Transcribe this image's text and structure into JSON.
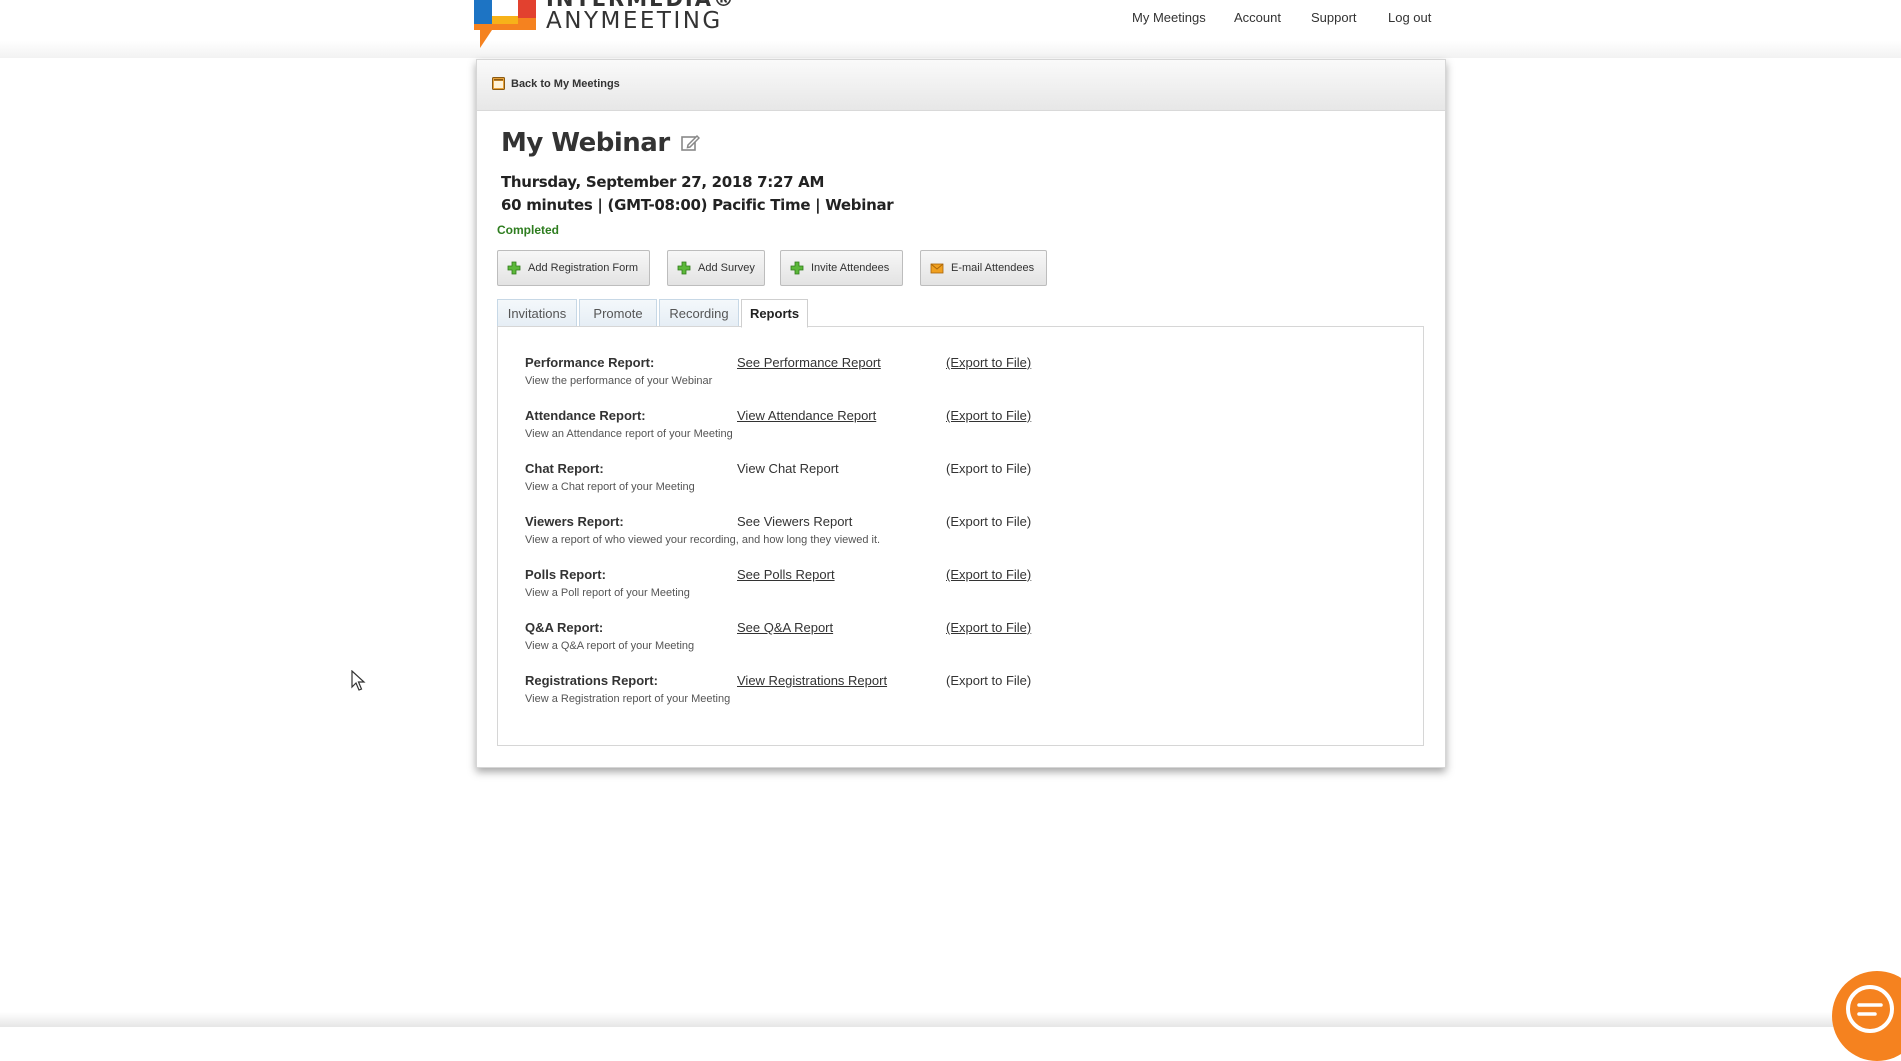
{
  "brand": {
    "line1": "INTERMEDIA®",
    "line2": "ANYMEETING",
    "colors": {
      "orange": "#f5821f",
      "blue": "#1d74c4",
      "red": "#e2412f",
      "yellow": "#f7b219"
    }
  },
  "nav": {
    "items": [
      "My Meetings",
      "Account",
      "Support",
      "Log out"
    ]
  },
  "header": {
    "back_label": "Back to My Meetings"
  },
  "meeting": {
    "title": "My Webinar",
    "datetime": "Thursday, September 27, 2018 7:27 AM",
    "details": "60 minutes | (GMT-08:00) Pacific Time | Webinar",
    "status": "Completed",
    "status_color": "#2e7d1f"
  },
  "actions": [
    {
      "label": "Add Registration Form",
      "icon": "plus-icon"
    },
    {
      "label": "Add Survey",
      "icon": "plus-icon"
    },
    {
      "label": "Invite Attendees",
      "icon": "plus-icon"
    },
    {
      "label": "E-mail Attendees",
      "icon": "envelope-icon"
    }
  ],
  "tabs": [
    {
      "label": "Invitations",
      "active": false
    },
    {
      "label": "Promote",
      "active": false
    },
    {
      "label": "Recording",
      "active": false
    },
    {
      "label": "Reports",
      "active": true
    }
  ],
  "reports": [
    {
      "name": "Performance Report:",
      "desc": "View the performance of your Webinar",
      "view": "See Performance Report",
      "view_link": true,
      "export": "(Export to File)",
      "export_link": true
    },
    {
      "name": "Attendance Report:",
      "desc": "View an Attendance report of your Meeting",
      "view": "View Attendance Report",
      "view_link": true,
      "export": "(Export to File)",
      "export_link": true
    },
    {
      "name": "Chat Report:",
      "desc": "View a Chat report of your Meeting",
      "view": "View Chat Report",
      "view_link": false,
      "export": "(Export to File)",
      "export_link": false
    },
    {
      "name": "Viewers Report:",
      "desc": "View a report of who viewed your recording, and how long they viewed it.",
      "view": "See Viewers Report",
      "view_link": false,
      "export": "(Export to File)",
      "export_link": false
    },
    {
      "name": "Polls Report:",
      "desc": "View a Poll report of your Meeting",
      "view": "See Polls Report",
      "view_link": true,
      "export": "(Export to File)",
      "export_link": true
    },
    {
      "name": "Q&A Report:",
      "desc": "View a Q&A report of your Meeting",
      "view": "See Q&A Report",
      "view_link": true,
      "export": "(Export to File)",
      "export_link": true
    },
    {
      "name": "Registrations Report:",
      "desc": "View a Registration report of your Meeting",
      "view": "View Registrations Report",
      "view_link": true,
      "export": "(Export to File)",
      "export_link": false
    }
  ]
}
